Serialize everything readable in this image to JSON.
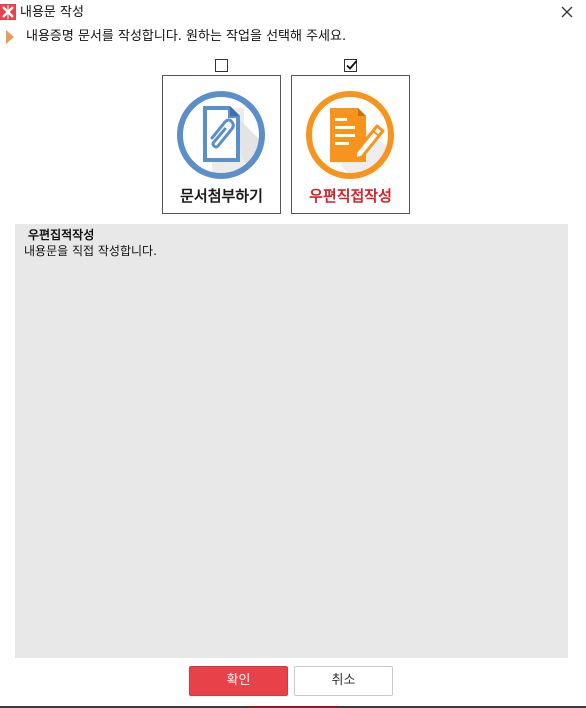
{
  "window": {
    "title": "내용문 작성",
    "icon": "app-logo-icon",
    "close_icon": "close-icon"
  },
  "instruction": {
    "icon": "triangle-pointer-icon",
    "text": "내용증명 문서를 작성합니다. 원하는 작업을 선택해 주세요."
  },
  "options": [
    {
      "label": "문서첨부하기",
      "icon": "paperclip-document-icon",
      "checked": false,
      "color": "#5b8fc9"
    },
    {
      "label": "우편직접작성",
      "icon": "document-pencil-icon",
      "checked": true,
      "color": "#f7941d"
    }
  ],
  "description": {
    "title": "우편집적작성",
    "body": "내용문을 직접 작성합니다."
  },
  "buttons": {
    "ok_label": "확인",
    "cancel_label": "취소"
  },
  "colors": {
    "accent": "#e8414a",
    "panel": "#e8e8e8",
    "selected_label": "#d2232a"
  }
}
